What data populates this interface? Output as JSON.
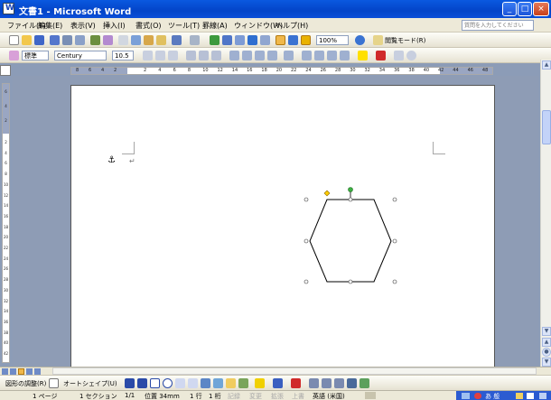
{
  "window": {
    "title": "文書1 - Microsoft Word"
  },
  "window_controls": {
    "minimize": "_",
    "maximize": "□",
    "close": "×"
  },
  "menu": {
    "items": [
      "ファイル(F)",
      "編集(E)",
      "表示(V)",
      "挿入(I)",
      "書式(O)",
      "ツール(T)",
      "罫線(A)",
      "ウィンドウ(W)",
      "ヘルプ(H)"
    ],
    "help_placeholder": "質問を入力してください"
  },
  "standard_toolbar": {
    "zoom": "100%",
    "read_mode": "閲覧モード(R)"
  },
  "format_toolbar": {
    "style": "標準",
    "font": "Century",
    "size": "10.5"
  },
  "ruler": {
    "h_left_numbers": [
      "8",
      "6",
      "4",
      "2"
    ],
    "h_numbers": [
      "2",
      "4",
      "6",
      "8",
      "10",
      "12",
      "14",
      "16",
      "18",
      "20",
      "22",
      "24",
      "26",
      "28",
      "30",
      "32",
      "34",
      "36",
      "38",
      "40",
      "42",
      "44",
      "46",
      "48"
    ],
    "v_top_numbers": [
      "6",
      "4",
      "2"
    ],
    "v_numbers": [
      "2",
      "4",
      "6",
      "8",
      "10",
      "12",
      "14",
      "16",
      "18",
      "20",
      "22",
      "24",
      "26",
      "28",
      "30",
      "32",
      "34",
      "36",
      "38",
      "40",
      "42"
    ]
  },
  "document": {
    "anchor_icon": "anchor-icon",
    "paragraph_mark": "↵"
  },
  "shape": {
    "type": "hexagon",
    "fill": "#ffffff",
    "stroke": "#000000",
    "adjust_handle_color": "#ffcc00",
    "rotate_handle_color": "#3cb043"
  },
  "drawing_toolbar": {
    "draw_menu": "図形の調整(R)",
    "autoshapes": "オートシェイプ(U)"
  },
  "status": {
    "page": "1 ページ",
    "section": "1 セクション",
    "page_of": "1/1",
    "position": "位置 34mm",
    "line": "1 行",
    "column": "1 桁",
    "rec": "記録",
    "trk": "変更",
    "ext": "拡張",
    "ovr": "上書",
    "language": "英語 (米国)"
  },
  "colors": {
    "titlebar": "#0a59e0",
    "workspace": "#8e9cb5",
    "toolbar_bg": "#ece9d8"
  }
}
